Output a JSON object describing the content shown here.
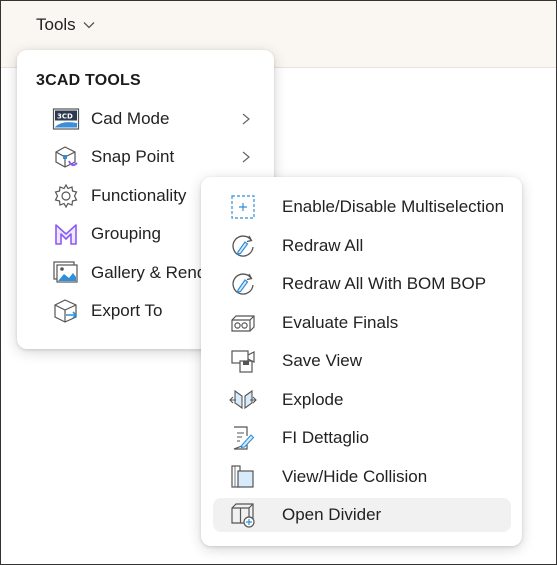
{
  "topbar": {
    "menu_label": "Tools"
  },
  "main_menu": {
    "title": "3CAD TOOLS",
    "items": [
      {
        "label": "Cad Mode",
        "icon": "cad-mode-icon",
        "has_submenu": true
      },
      {
        "label": "Snap Point",
        "icon": "snap-point-icon",
        "has_submenu": true
      },
      {
        "label": "Functionality",
        "icon": "gear-icon",
        "has_submenu": false
      },
      {
        "label": "Grouping",
        "icon": "grouping-icon",
        "has_submenu": false
      },
      {
        "label": "Gallery & Rend",
        "icon": "gallery-icon",
        "has_submenu": false
      },
      {
        "label": "Export To",
        "icon": "export-icon",
        "has_submenu": false
      }
    ]
  },
  "sub_menu": {
    "items": [
      {
        "label": "Enable/Disable Multiselection",
        "icon": "multiselection-icon"
      },
      {
        "label": "Redraw All",
        "icon": "redraw-icon"
      },
      {
        "label": "Redraw All With BOM BOP",
        "icon": "redraw-bom-icon"
      },
      {
        "label": "Evaluate Finals",
        "icon": "evaluate-finals-icon"
      },
      {
        "label": "Save View",
        "icon": "save-view-icon"
      },
      {
        "label": "Explode",
        "icon": "explode-icon"
      },
      {
        "label": "FI Dettaglio",
        "icon": "detail-edit-icon"
      },
      {
        "label": "View/Hide Collision",
        "icon": "collision-icon"
      },
      {
        "label": "Open Divider",
        "icon": "open-divider-icon",
        "active": true
      }
    ]
  },
  "colors": {
    "topbar_bg": "#faf6f2",
    "accent_blue": "#2f8fd8",
    "accent_purple": "#8b5cf6",
    "hover_bg": "#f1f1f1"
  }
}
